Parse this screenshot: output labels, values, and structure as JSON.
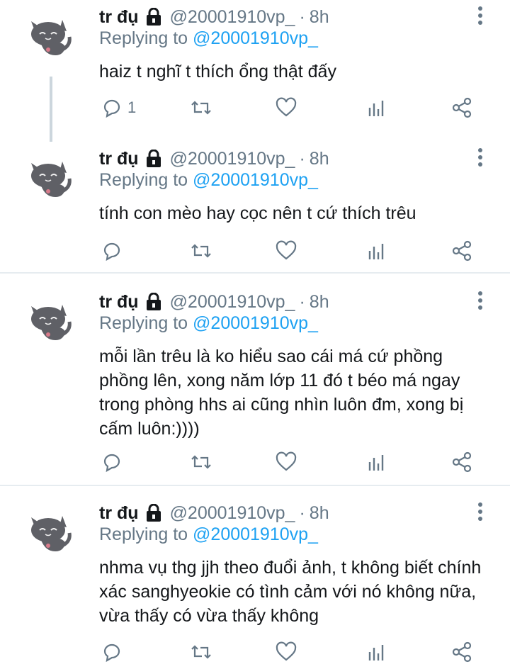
{
  "tweets": [
    {
      "name": "tr đụ",
      "handle": "@20001910vp_",
      "sep": "·",
      "time": "8h",
      "replying_prefix": "Replying to ",
      "replying_handle": "@20001910vp_",
      "text": "haiz t nghĩ t thích ổng thật đấy",
      "reply_count": "1"
    },
    {
      "name": "tr đụ",
      "handle": "@20001910vp_",
      "sep": "·",
      "time": "8h",
      "replying_prefix": "Replying to ",
      "replying_handle": "@20001910vp_",
      "text": "tính con mèo hay cọc nên t cứ thích trêu",
      "reply_count": ""
    },
    {
      "name": "tr đụ",
      "handle": "@20001910vp_",
      "sep": "·",
      "time": "8h",
      "replying_prefix": "Replying to ",
      "replying_handle": "@20001910vp_",
      "text": "mỗi lần trêu là ko hiểu sao cái má cứ phồng phồng lên, xong năm lớp 11 đó t béo má ngay trong phòng hhs ai cũng nhìn luôn đm, xong bị cấm luôn:))))",
      "reply_count": ""
    },
    {
      "name": "tr đụ",
      "handle": "@20001910vp_",
      "sep": "·",
      "time": "8h",
      "replying_prefix": "Replying to ",
      "replying_handle": "@20001910vp_",
      "text": "nhma vụ thg jjh theo đuổi ảnh, t không biết chính xác sanghyeokie có tình cảm với nó không nữa, vừa thấy có vừa thấy không",
      "reply_count": ""
    }
  ],
  "colors": {
    "text": "#14171a",
    "muted": "#657786",
    "link": "#1da1f2",
    "divider": "#e6ecf0",
    "avatar_cat": "#5f6066"
  },
  "icons": [
    "lock-icon",
    "more-options-icon",
    "reply-icon",
    "retweet-icon",
    "like-icon",
    "analytics-icon",
    "share-icon"
  ]
}
